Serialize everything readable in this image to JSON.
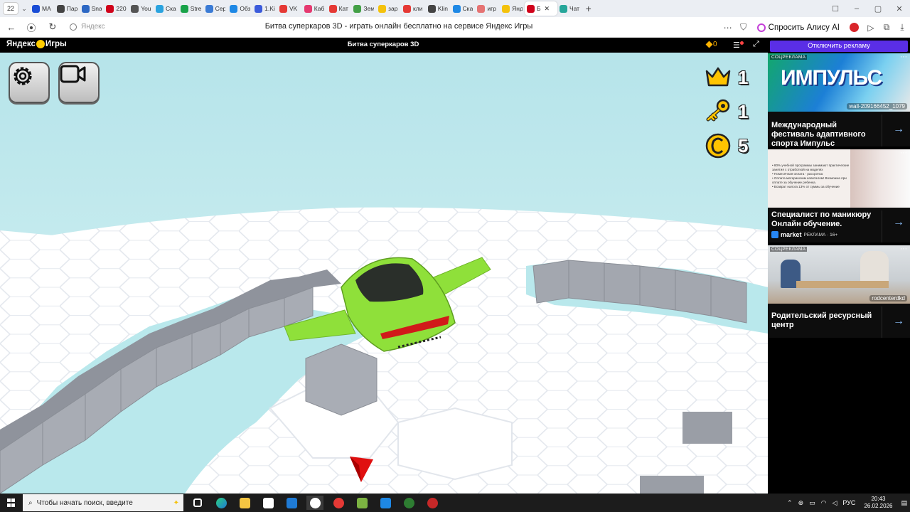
{
  "browser": {
    "tab_count": "22",
    "tabs": [
      {
        "title": "MA",
        "color": "#1a4dd6"
      },
      {
        "title": "Пар",
        "color": "#444444"
      },
      {
        "title": "Sna",
        "color": "#2d68c4"
      },
      {
        "title": "220",
        "color": "#d0021b"
      },
      {
        "title": "You",
        "color": "#555555"
      },
      {
        "title": "Ска",
        "color": "#2aa3df"
      },
      {
        "title": "Stre",
        "color": "#1aa34a"
      },
      {
        "title": "Сер",
        "color": "#3a7bd5"
      },
      {
        "title": "Обз",
        "color": "#1e88e5"
      },
      {
        "title": "1.Ki",
        "color": "#3b5bdb"
      },
      {
        "title": "VK",
        "color": "#e53935"
      },
      {
        "title": "Каб",
        "color": "#e53970"
      },
      {
        "title": "Кат",
        "color": "#e53935"
      },
      {
        "title": "Зем",
        "color": "#43a047"
      },
      {
        "title": "зар",
        "color": "#f4c20d"
      },
      {
        "title": "кли",
        "color": "#e53935"
      },
      {
        "title": "Klin",
        "color": "#444444"
      },
      {
        "title": "Ска",
        "color": "#1e88e5"
      },
      {
        "title": "игр",
        "color": "#e57373"
      },
      {
        "title": "Янд",
        "color": "#f4c20d"
      }
    ],
    "active_tab": {
      "title": "Б",
      "color": "#d0021b"
    },
    "extra_tab": {
      "title": "Чат",
      "color": "#26a69a"
    },
    "address_domain": "Яндекс",
    "page_title": "Битва суперкаров 3D - играть онлайн бесплатно на сервисе Яндекс Игры",
    "alice_label": "Спросить Алису AI"
  },
  "yandex_header": {
    "logo_left": "Яндекс",
    "logo_right": "Игры",
    "game_title": "Битва суперкаров 3D",
    "coins": "0"
  },
  "game": {
    "settings_icon": "gear-icon",
    "camera_icon": "video-camera-icon",
    "crowns": "1",
    "keys": "1",
    "coins": "5",
    "colors": {
      "car": "#8fe03a",
      "pointer": "#e01010",
      "water": "#b9e8ec"
    }
  },
  "ads": {
    "disable_label": "Отключить рекламу",
    "cards": [
      {
        "badge": "СОЦРЕКЛАМА",
        "image_text": "ИМПУЛЬС",
        "source": "wall-209166452_1079",
        "text": "Международный фестиваль адаптивного спорта Импульс"
      },
      {
        "badge": "",
        "image_lines": [
          "• 80% учебной программы занимают практические занятия с отработкой на моделях",
          "• Помесячная оплата - рассрочка",
          "• Оплата материнским капиталом! Возможна при оплате за обучение ребенка.",
          "• Возврат налога 13% от суммы за обучение"
        ],
        "text": "Специалист по маникюру Онлайн обучение.",
        "meta_brand": "market",
        "meta_label": "РЕКЛАМА · 16+"
      },
      {
        "badge": "СОЦРЕКЛАМА",
        "source": "rodcenterdkd",
        "text": "Родительский ресурсный центр"
      }
    ]
  },
  "taskbar": {
    "search_placeholder": "Чтобы начать поиск, введите",
    "language": "РУС",
    "time": "20:43",
    "date": "26.02.2026"
  }
}
